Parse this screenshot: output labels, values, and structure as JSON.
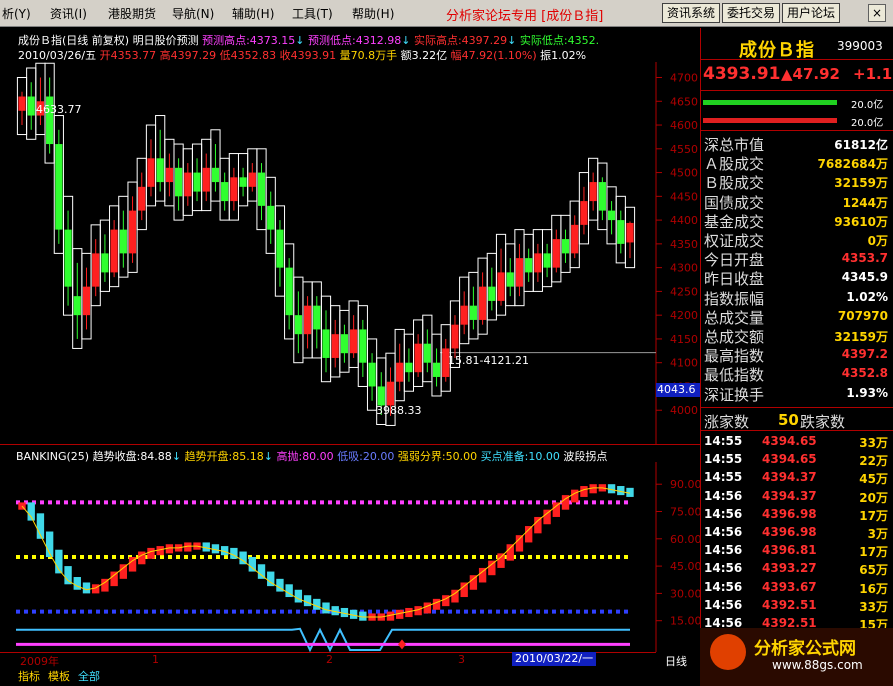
{
  "menubar": {
    "items": [
      {
        "label": "析(Y)"
      },
      {
        "label": "资讯(I)"
      },
      {
        "label": "港股期货"
      },
      {
        "label": "导航(N)"
      },
      {
        "label": "辅助(H)"
      },
      {
        "label": "工具(T)"
      },
      {
        "label": "帮助(H)"
      }
    ],
    "center_title": "分析家论坛专用 [成份Ｂ指]",
    "buttons": [
      "资讯系统",
      "委托交易",
      "用户论坛"
    ],
    "close_label": "×"
  },
  "info": {
    "line1_title": "成份Ｂ指(日线 前复权) 明日股价预测",
    "pred_high_label": "预测高点:",
    "pred_high": "4373.15",
    "pred_low_label": "预测低点:",
    "pred_low": "4312.98",
    "act_high_label": "实际高点:",
    "act_high": "4397.29",
    "act_low_label": "实际低点:",
    "act_low": "4352.",
    "date": "2010/03/26/五",
    "open": "开4353.77",
    "high": "高4397.29",
    "low": "低4352.83",
    "close": "收4393.91",
    "vol": "量70.8万手",
    "amount": "额3.22亿",
    "amp": "幅47.92(1.10%)",
    "zhen": "振1.02%"
  },
  "main_chart": {
    "ymin": 3950,
    "ymax": 4720,
    "y_ticks": [
      4700,
      4650,
      4600,
      4550,
      4500,
      4450,
      4400,
      4350,
      4300,
      4250,
      4200,
      4150,
      4100,
      4050,
      4000
    ],
    "y_tick_labels": [
      "4700",
      "4650",
      "4600",
      "4550",
      "4500",
      "4450",
      "4400",
      "4350",
      "4300",
      "4250",
      "4200",
      "4150",
      "4100",
      "4050",
      "4000"
    ],
    "annot_high": "4633.77",
    "annot_low": "3988.33",
    "annot_range": "15.81-4121.21",
    "price_tag": "4043.6",
    "ref_value": 4121.21,
    "tag_value": 4043.6,
    "high_value": 4633.77,
    "low_value": 3988.33
  },
  "indicator": {
    "name": "BANKING(25)",
    "trend_close_label": "趋势收盘:",
    "trend_close": "84.88",
    "trend_open_label": "趋势开盘:",
    "trend_open": "85.18",
    "high_label": "高抛:",
    "high_val": "80.00",
    "low_label": "低吸:",
    "low_val": "20.00",
    "strong_label": "强弱分界:",
    "strong_val": "50.00",
    "buy_label": "买点准备:",
    "buy_val": "10.00",
    "wave_label": "波段拐点",
    "ymin": 0,
    "ymax": 100,
    "y_ticks": [
      90,
      75,
      60,
      45,
      30,
      15
    ],
    "y_tick_labels": [
      "90.00",
      "75.00",
      "60.00",
      "45.00",
      "30.00",
      "15.00"
    ]
  },
  "x_axis": {
    "labels": [
      "2009年",
      "1",
      "2",
      "3"
    ],
    "cursor_date": "2010/03/22/一",
    "period": "日线"
  },
  "bottom_tabs": [
    "指标",
    "模板",
    "全部"
  ],
  "quote": {
    "title": "成份Ｂ指",
    "code": "399003",
    "price": "4393.91",
    "change": "▲47.92",
    "pct": "+1.1",
    "bar1_label": "20.0亿",
    "bar2_label": "20.0亿",
    "rows": [
      {
        "label": "深总市值",
        "value": "61812亿",
        "color": "#ffffff"
      },
      {
        "label": "Ａ股成交",
        "value": "7682684万",
        "color": "#ffd400"
      },
      {
        "label": "Ｂ股成交",
        "value": "32159万",
        "color": "#ffd400"
      },
      {
        "label": "国债成交",
        "value": "1244万",
        "color": "#ffd400"
      },
      {
        "label": "基金成交",
        "value": "93610万",
        "color": "#ffd400"
      },
      {
        "label": "权证成交",
        "value": "0万",
        "color": "#ffd400"
      },
      {
        "label": "今日开盘",
        "value": "4353.7",
        "color": "#ff3030"
      },
      {
        "label": "昨日收盘",
        "value": "4345.9",
        "color": "#ffffff"
      },
      {
        "label": "指数振幅",
        "value": "1.02%",
        "color": "#ffffff"
      },
      {
        "label": "总成交量",
        "value": "707970",
        "color": "#ffd400"
      },
      {
        "label": "总成交额",
        "value": "32159万",
        "color": "#ffd400"
      },
      {
        "label": "最高指数",
        "value": "4397.2",
        "color": "#ff3030"
      },
      {
        "label": "最低指数",
        "value": "4352.8",
        "color": "#ff3030"
      },
      {
        "label": "深证换手",
        "value": "1.93%",
        "color": "#ffffff"
      }
    ],
    "updown_label_up": "涨家数",
    "updown_val": "50",
    "updown_label_down": "跌家数",
    "ticks": [
      {
        "time": "14:55",
        "price": "4394.65",
        "vol": "33万"
      },
      {
        "time": "14:55",
        "price": "4394.65",
        "vol": "22万"
      },
      {
        "time": "14:55",
        "price": "4394.37",
        "vol": "45万"
      },
      {
        "time": "14:56",
        "price": "4394.37",
        "vol": "20万"
      },
      {
        "time": "14:56",
        "price": "4396.98",
        "vol": "17万"
      },
      {
        "time": "14:56",
        "price": "4396.98",
        "vol": "3万"
      },
      {
        "time": "14:56",
        "price": "4396.81",
        "vol": "17万"
      },
      {
        "time": "14:56",
        "price": "4393.27",
        "vol": "65万"
      },
      {
        "time": "14:56",
        "price": "4393.67",
        "vol": "16万"
      },
      {
        "time": "14:56",
        "price": "4392.51",
        "vol": "33万"
      },
      {
        "time": "14:56",
        "price": "4392.51",
        "vol": "15万"
      }
    ]
  },
  "watermark": {
    "main": "分析家公式网",
    "sub": "www.88gs.com"
  },
  "colors": {
    "up": "#ff2020",
    "down": "#30ff30",
    "yellow": "#ffd400",
    "magenta": "#ff40ff",
    "cyan": "#40e0ff",
    "blue": "#3040ff",
    "border": "#b00000"
  },
  "chart_data": {
    "type": "candlestick",
    "candles": [
      {
        "o": 4630,
        "c": 4660,
        "h": 4670,
        "l": 4600,
        "up": true
      },
      {
        "o": 4660,
        "c": 4620,
        "h": 4690,
        "l": 4590,
        "up": false
      },
      {
        "o": 4620,
        "c": 4650,
        "h": 4700,
        "l": 4600,
        "up": true
      },
      {
        "o": 4660,
        "c": 4560,
        "h": 4700,
        "l": 4540,
        "up": false
      },
      {
        "o": 4560,
        "c": 4380,
        "h": 4590,
        "l": 4350,
        "up": false
      },
      {
        "o": 4380,
        "c": 4260,
        "h": 4420,
        "l": 4220,
        "up": false
      },
      {
        "o": 4240,
        "c": 4200,
        "h": 4310,
        "l": 4150,
        "up": false
      },
      {
        "o": 4200,
        "c": 4260,
        "h": 4300,
        "l": 4170,
        "up": true
      },
      {
        "o": 4260,
        "c": 4330,
        "h": 4360,
        "l": 4240,
        "up": true
      },
      {
        "o": 4330,
        "c": 4290,
        "h": 4370,
        "l": 4270,
        "up": false
      },
      {
        "o": 4290,
        "c": 4380,
        "h": 4400,
        "l": 4280,
        "up": true
      },
      {
        "o": 4380,
        "c": 4330,
        "h": 4420,
        "l": 4300,
        "up": false
      },
      {
        "o": 4330,
        "c": 4420,
        "h": 4450,
        "l": 4310,
        "up": true
      },
      {
        "o": 4420,
        "c": 4470,
        "h": 4500,
        "l": 4400,
        "up": true
      },
      {
        "o": 4470,
        "c": 4530,
        "h": 4570,
        "l": 4450,
        "up": true
      },
      {
        "o": 4530,
        "c": 4480,
        "h": 4590,
        "l": 4460,
        "up": false
      },
      {
        "o": 4480,
        "c": 4510,
        "h": 4540,
        "l": 4450,
        "up": true
      },
      {
        "o": 4510,
        "c": 4450,
        "h": 4530,
        "l": 4420,
        "up": false
      },
      {
        "o": 4450,
        "c": 4500,
        "h": 4520,
        "l": 4430,
        "up": true
      },
      {
        "o": 4500,
        "c": 4460,
        "h": 4530,
        "l": 4440,
        "up": false
      },
      {
        "o": 4460,
        "c": 4510,
        "h": 4540,
        "l": 4440,
        "up": true
      },
      {
        "o": 4510,
        "c": 4480,
        "h": 4560,
        "l": 4460,
        "up": false
      },
      {
        "o": 4480,
        "c": 4440,
        "h": 4500,
        "l": 4420,
        "up": false
      },
      {
        "o": 4440,
        "c": 4490,
        "h": 4510,
        "l": 4420,
        "up": true
      },
      {
        "o": 4490,
        "c": 4470,
        "h": 4510,
        "l": 4450,
        "up": false
      },
      {
        "o": 4470,
        "c": 4500,
        "h": 4520,
        "l": 4460,
        "up": true
      },
      {
        "o": 4500,
        "c": 4430,
        "h": 4520,
        "l": 4400,
        "up": false
      },
      {
        "o": 4430,
        "c": 4380,
        "h": 4460,
        "l": 4350,
        "up": false
      },
      {
        "o": 4380,
        "c": 4300,
        "h": 4400,
        "l": 4260,
        "up": false
      },
      {
        "o": 4300,
        "c": 4200,
        "h": 4320,
        "l": 4170,
        "up": false
      },
      {
        "o": 4200,
        "c": 4160,
        "h": 4250,
        "l": 4120,
        "up": false
      },
      {
        "o": 4160,
        "c": 4220,
        "h": 4240,
        "l": 4130,
        "up": true
      },
      {
        "o": 4220,
        "c": 4170,
        "h": 4240,
        "l": 4130,
        "up": false
      },
      {
        "o": 4170,
        "c": 4110,
        "h": 4210,
        "l": 4080,
        "up": false
      },
      {
        "o": 4110,
        "c": 4160,
        "h": 4190,
        "l": 4090,
        "up": true
      },
      {
        "o": 4160,
        "c": 4120,
        "h": 4180,
        "l": 4100,
        "up": false
      },
      {
        "o": 4120,
        "c": 4170,
        "h": 4200,
        "l": 4110,
        "up": true
      },
      {
        "o": 4170,
        "c": 4100,
        "h": 4190,
        "l": 4070,
        "up": false
      },
      {
        "o": 4100,
        "c": 4050,
        "h": 4120,
        "l": 4020,
        "up": false
      },
      {
        "o": 4050,
        "c": 4010,
        "h": 4080,
        "l": 3990,
        "up": false
      },
      {
        "o": 4010,
        "c": 4060,
        "h": 4090,
        "l": 3988,
        "up": true
      },
      {
        "o": 4060,
        "c": 4100,
        "h": 4140,
        "l": 4040,
        "up": true
      },
      {
        "o": 4100,
        "c": 4080,
        "h": 4130,
        "l": 4060,
        "up": false
      },
      {
        "o": 4080,
        "c": 4140,
        "h": 4160,
        "l": 4070,
        "up": true
      },
      {
        "o": 4140,
        "c": 4100,
        "h": 4170,
        "l": 4080,
        "up": false
      },
      {
        "o": 4100,
        "c": 4070,
        "h": 4130,
        "l": 4050,
        "up": false
      },
      {
        "o": 4070,
        "c": 4130,
        "h": 4150,
        "l": 4060,
        "up": true
      },
      {
        "o": 4130,
        "c": 4180,
        "h": 4200,
        "l": 4110,
        "up": true
      },
      {
        "o": 4180,
        "c": 4220,
        "h": 4250,
        "l": 4160,
        "up": true
      },
      {
        "o": 4220,
        "c": 4190,
        "h": 4260,
        "l": 4170,
        "up": false
      },
      {
        "o": 4190,
        "c": 4260,
        "h": 4290,
        "l": 4180,
        "up": true
      },
      {
        "o": 4260,
        "c": 4230,
        "h": 4300,
        "l": 4210,
        "up": false
      },
      {
        "o": 4230,
        "c": 4290,
        "h": 4340,
        "l": 4220,
        "up": true
      },
      {
        "o": 4290,
        "c": 4260,
        "h": 4320,
        "l": 4240,
        "up": false
      },
      {
        "o": 4260,
        "c": 4320,
        "h": 4350,
        "l": 4240,
        "up": true
      },
      {
        "o": 4320,
        "c": 4290,
        "h": 4340,
        "l": 4270,
        "up": false
      },
      {
        "o": 4290,
        "c": 4330,
        "h": 4350,
        "l": 4270,
        "up": true
      },
      {
        "o": 4330,
        "c": 4300,
        "h": 4350,
        "l": 4280,
        "up": false
      },
      {
        "o": 4300,
        "c": 4360,
        "h": 4380,
        "l": 4290,
        "up": true
      },
      {
        "o": 4360,
        "c": 4330,
        "h": 4380,
        "l": 4310,
        "up": false
      },
      {
        "o": 4330,
        "c": 4390,
        "h": 4410,
        "l": 4320,
        "up": true
      },
      {
        "o": 4390,
        "c": 4440,
        "h": 4470,
        "l": 4370,
        "up": true
      },
      {
        "o": 4440,
        "c": 4480,
        "h": 4500,
        "l": 4420,
        "up": true
      },
      {
        "o": 4480,
        "c": 4420,
        "h": 4490,
        "l": 4400,
        "up": false
      },
      {
        "o": 4420,
        "c": 4400,
        "h": 4440,
        "l": 4370,
        "up": false
      },
      {
        "o": 4400,
        "c": 4350,
        "h": 4420,
        "l": 4330,
        "up": false
      },
      {
        "o": 4353,
        "c": 4394,
        "h": 4397,
        "l": 4320,
        "up": true
      }
    ],
    "indicator_values": [
      78,
      72,
      62,
      52,
      43,
      37,
      34,
      32,
      33,
      36,
      40,
      44,
      48,
      51,
      53,
      54,
      55,
      55,
      56,
      56,
      55,
      54,
      53,
      51,
      48,
      44,
      40,
      36,
      33,
      30,
      27,
      25,
      23,
      21,
      20,
      19,
      18,
      17,
      17,
      17,
      18,
      19,
      20,
      21,
      23,
      25,
      27,
      30,
      34,
      38,
      42,
      46,
      50,
      55,
      60,
      65,
      70,
      74,
      78,
      82,
      85,
      87,
      88,
      88,
      87,
      86,
      85
    ],
    "ylim": [
      3950,
      4720
    ]
  }
}
